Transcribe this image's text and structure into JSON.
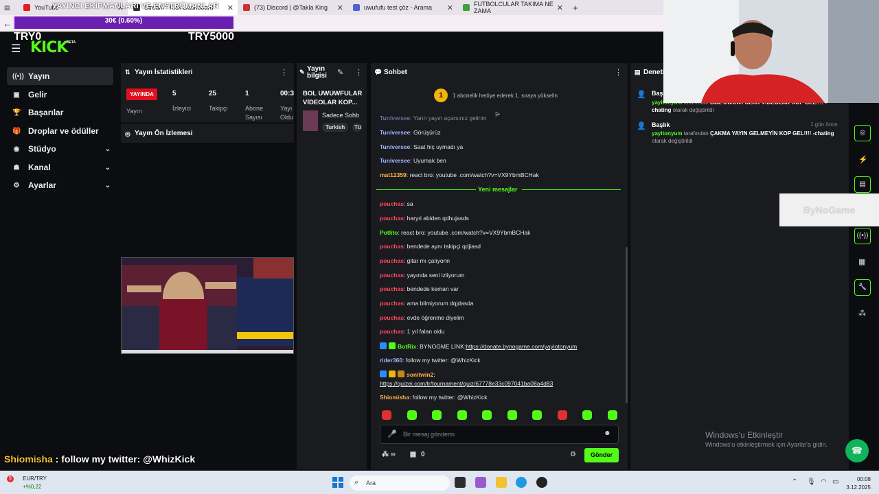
{
  "browser": {
    "tabs": [
      {
        "label": "YouTube",
        "icon_color": "#e02020"
      },
      {
        "label": "Stream - Kick Dashboard",
        "icon_color": "#333333"
      },
      {
        "label": "(73) Discord | @Takla King",
        "icon_color": "#d03030"
      },
      {
        "label": "uwufufu test çöz - Arama",
        "icon_color": "#5060d0"
      },
      {
        "label": "FUTBOLCULAR TAKIMA NE ZAMA",
        "icon_color": "#40a040"
      }
    ],
    "new_tab": "+"
  },
  "overlay": {
    "title": "YAYINCI EKİPMANLARI VE ENSTRÜMANLAR",
    "donation": "30€ (0.60%)",
    "donation_progress": 0.006,
    "left_counter": "TRY0",
    "right_counter": "TRY5000",
    "chat_user": "Shiomisha",
    "chat_text": " : follow my twitter: @WhizKick"
  },
  "app": {
    "logo": "KICK",
    "beta": "BETA"
  },
  "sidebar": {
    "items": [
      {
        "label": "Yayın",
        "icon": "broadcast-icon",
        "glyph": "((•))",
        "active": true
      },
      {
        "label": "Gelir",
        "icon": "wallet-icon",
        "glyph": "▣"
      },
      {
        "label": "Başarılar",
        "icon": "trophy-icon",
        "glyph": "🏆"
      },
      {
        "label": "Droplar ve ödüller",
        "icon": "gift-icon",
        "glyph": "🎁"
      },
      {
        "label": "Stüdyo",
        "icon": "studio-icon",
        "glyph": "◉",
        "expand": true
      },
      {
        "label": "Kanal",
        "icon": "channel-icon",
        "glyph": "☗",
        "expand": true
      },
      {
        "label": "Ayarlar",
        "icon": "settings-icon",
        "glyph": "⚙",
        "expand": true
      }
    ]
  },
  "stats": {
    "title": "Yayın İstatistikleri",
    "live": "YAYINDA",
    "items": [
      {
        "value": "",
        "label": "Yayın"
      },
      {
        "value": "5",
        "label": "İzleyici"
      },
      {
        "value": "25",
        "label": "Takipçi"
      },
      {
        "value": "1",
        "label": "Abone Sayısı"
      },
      {
        "value": "00:3",
        "label": "Yayı Oldu"
      }
    ]
  },
  "preview": {
    "title": "Yayın Ön İzlemesi"
  },
  "info": {
    "title": "Yayın bilgisi",
    "stream_title": "BOL UWUWFULAR VİDEOLAR KOP...",
    "category": "Sadece Sohb",
    "tags": [
      "Turkish",
      "Tü"
    ]
  },
  "chat": {
    "title": "Sohbet",
    "sub_rank": "1",
    "sub_banner": "1 abonelik hediye ederek 1. sıraya yükselin",
    "new_messages": "Yeni mesajlar",
    "placeholder": "Bir mesaj gönderin",
    "send": "Gönder",
    "footer_count": "∞",
    "footer_gift_count": "0",
    "messages": [
      {
        "user": "Tuniversee",
        "color": "#9fb6ff",
        "text": ": Yarın yayın açarsınız gelirim"
      },
      {
        "user": "Tuniversee",
        "color": "#9fb6ff",
        "text": ": Görüşürüz"
      },
      {
        "user": "Tuniversee",
        "color": "#9fb6ff",
        "text": ": Saat hiç uymadı ya"
      },
      {
        "user": "Tuniversee",
        "color": "#9fb6ff",
        "text": ": Uyumak ben"
      },
      {
        "user": "mat12359",
        "color": "#ffb347",
        "text": ": react bro: youtube .com/watch?v=VX9YbmBCHak"
      },
      {
        "user": "pouchas",
        "color": "#ff4a5a",
        "text": ": sa"
      },
      {
        "user": "pouchas",
        "color": "#ff4a5a",
        "text": ": haryri abiden qdhujasds"
      },
      {
        "user": "Potlito",
        "color": "#53fc18",
        "text": ": react bro: youtube .com/watch?v=VX9YbmBCHak"
      },
      {
        "user": "pouchas",
        "color": "#ff4a5a",
        "text": ": bendede aynı takipçi qdjiasd"
      },
      {
        "user": "pouchas",
        "color": "#ff4a5a",
        "text": ": gitar mı çalıyonn"
      },
      {
        "user": "pouchas",
        "color": "#ff4a5a",
        "text": ": yayında seni izliyorum"
      },
      {
        "user": "pouchas",
        "color": "#ff4a5a",
        "text": ": bendede keman var"
      },
      {
        "user": "pouchas",
        "color": "#ff4a5a",
        "text": ": ama bilmiyorum dqjdasda"
      },
      {
        "user": "pouchas",
        "color": "#ff4a5a",
        "text": ": evde öğrenme diyelim"
      },
      {
        "user": "pouchas",
        "color": "#ff4a5a",
        "text": ": 1 yıl falan oldu"
      },
      {
        "user": "BotRix",
        "color": "#53fc18",
        "text": ": BYNOGME LİNK:",
        "link": "https://donate.bynogame.com/yayiotonyum",
        "badges": [
          "#2a8cff",
          "#53fc18"
        ]
      },
      {
        "user": "rider360",
        "color": "#9fb6ff",
        "text": ": follow my twitter: @WhizKick"
      },
      {
        "user": "sonitwin2",
        "color": "#ffb347",
        "text": ":",
        "link2": "https://quizei.com/tr/tournament/quiz/67778e33c097041ba08a4d83",
        "badges": [
          "#2a8cff",
          "#f2b30c",
          "#c7851a"
        ]
      },
      {
        "user": "Shiomisha",
        "color": "#ffb347",
        "text": ": follow my twitter: @WhizKick"
      }
    ],
    "emote_colors": [
      "#e03030",
      "#53fc18",
      "#53fc18",
      "#53fc18",
      "#53fc18",
      "#53fc18",
      "#53fc18",
      "#e03030",
      "#53fc18",
      "#53fc18"
    ]
  },
  "audit": {
    "title": "Denetim",
    "entries": [
      {
        "title": "Başlık",
        "time": "",
        "user": "yayitonyum",
        "mid": " tarafından ",
        "value": "BOL UWUWFULAR VİDEOLAR KOP GEL!!!! -chating",
        "end": " olarak değiştirildi"
      },
      {
        "title": "Başlık",
        "time": "1 gün önce",
        "user": "yayitonyum",
        "mid": " tarafından ",
        "value": "ÇAKMA YAYIN GELMEYİN KOP GEL!!!! -chating",
        "end": " olarak değiştirildi"
      }
    ]
  },
  "ads": {
    "bynogame": "ByNoGame"
  },
  "windows_notice": {
    "title": "Windows'u Etkinleştir",
    "subtitle": "Windows'u etkinleştirmek için Ayarlar'a gidin."
  },
  "taskbar": {
    "ticker_badge": "5",
    "ticker_name": "EUR/TRY",
    "ticker_change": "+%0,22",
    "search": "Ara",
    "time": "00:08",
    "date": "3.12.2025"
  }
}
